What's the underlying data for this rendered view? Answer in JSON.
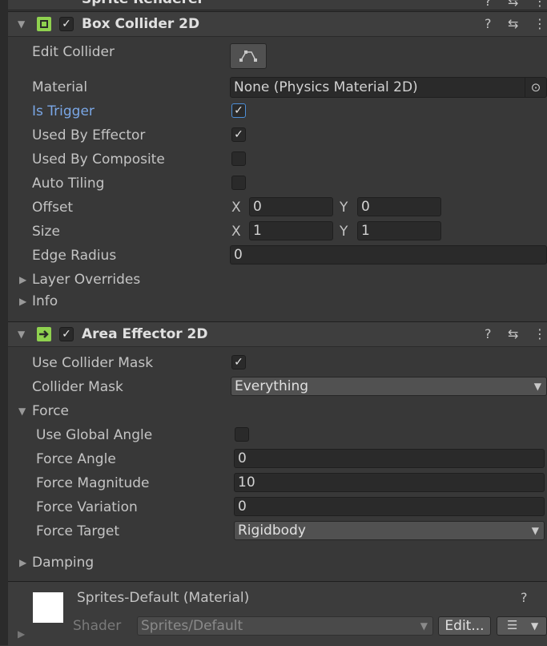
{
  "top_header": {
    "title": "Sprite Renderer"
  },
  "box_collider": {
    "title": "Box Collider 2D",
    "enabled": true,
    "fields": {
      "edit_collider": "Edit Collider",
      "material_label": "Material",
      "material_value": "None (Physics Material 2D)",
      "is_trigger_label": "Is Trigger",
      "is_trigger": true,
      "used_by_effector_label": "Used By Effector",
      "used_by_effector": true,
      "used_by_composite_label": "Used By Composite",
      "used_by_composite": false,
      "auto_tiling_label": "Auto Tiling",
      "auto_tiling": false,
      "offset_label": "Offset",
      "offset_x": "0",
      "offset_y": "0",
      "size_label": "Size",
      "size_x": "1",
      "size_y": "1",
      "edge_radius_label": "Edge Radius",
      "edge_radius": "0",
      "layer_overrides_label": "Layer Overrides",
      "info_label": "Info",
      "x_axis": "X",
      "y_axis": "Y"
    }
  },
  "area_effector": {
    "title": "Area Effector 2D",
    "enabled": true,
    "fields": {
      "use_collider_mask_label": "Use Collider Mask",
      "use_collider_mask": true,
      "collider_mask_label": "Collider Mask",
      "collider_mask_value": "Everything",
      "force_label": "Force",
      "use_global_angle_label": "Use Global Angle",
      "use_global_angle": false,
      "force_angle_label": "Force Angle",
      "force_angle": "0",
      "force_magnitude_label": "Force Magnitude",
      "force_magnitude": "10",
      "force_variation_label": "Force Variation",
      "force_variation": "0",
      "force_target_label": "Force Target",
      "force_target_value": "Rigidbody",
      "damping_label": "Damping"
    }
  },
  "material": {
    "name": "Sprites-Default (Material)",
    "shader_label": "Shader",
    "shader_value": "Sprites/Default",
    "edit_button": "Edit..."
  },
  "colors": {
    "accent_blue": "#7aa7e6",
    "component_icon_green": "#8fd14f"
  },
  "icons": [
    "help-icon",
    "preset-icon",
    "kebab-menu-icon",
    "foldout-arrow-icon",
    "edit-collider-icon",
    "object-picker-icon",
    "dropdown-arrow-icon"
  ]
}
